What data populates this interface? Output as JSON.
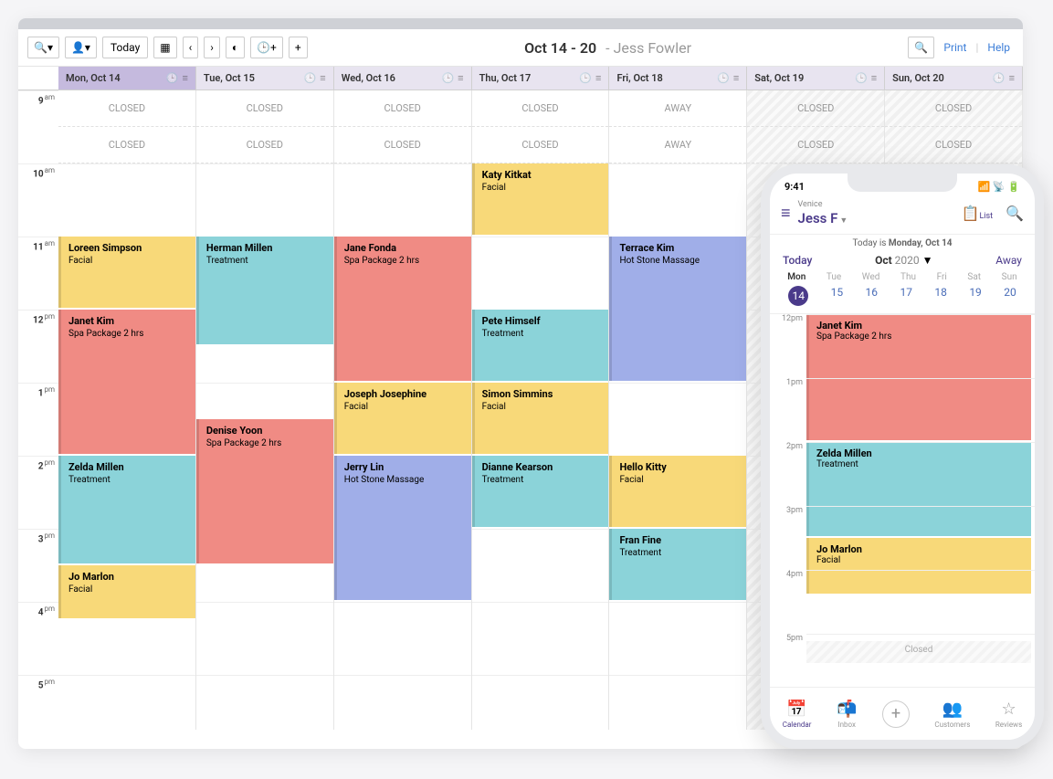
{
  "toolbar": {
    "today_label": "Today",
    "title_range": "Oct 14 - 20",
    "title_person": "- Jess Fowler",
    "print_label": "Print",
    "help_label": "Help"
  },
  "days": [
    {
      "label": "Mon, Oct 14",
      "selected": true,
      "status": "CLOSED"
    },
    {
      "label": "Tue, Oct 15",
      "selected": false,
      "status": "CLOSED"
    },
    {
      "label": "Wed, Oct 16",
      "selected": false,
      "status": "CLOSED"
    },
    {
      "label": "Thu, Oct 17",
      "selected": false,
      "status": "CLOSED"
    },
    {
      "label": "Fri, Oct 18",
      "selected": false,
      "status": "AWAY"
    },
    {
      "label": "Sat, Oct 19",
      "selected": false,
      "status": "CLOSED"
    },
    {
      "label": "Sun, Oct 20",
      "selected": false,
      "status": "CLOSED"
    }
  ],
  "hours": [
    "9",
    "10",
    "11",
    "12",
    "1",
    "2",
    "3",
    "4",
    "5"
  ],
  "ampm": [
    "am",
    "am",
    "am",
    "pm",
    "pm",
    "pm",
    "pm",
    "pm",
    "pm"
  ],
  "closed_text": "CLOSED",
  "away_text": "AWAY",
  "appointments": [
    {
      "day": 3,
      "start": 10,
      "dur": 1,
      "name": "Katy Kitkat",
      "service": "Facial",
      "color": "c-yellow"
    },
    {
      "day": 0,
      "start": 11,
      "dur": 1,
      "name": "Loreen Simpson",
      "service": "Facial",
      "color": "c-yellow"
    },
    {
      "day": 1,
      "start": 11,
      "dur": 1.5,
      "name": "Herman Millen",
      "service": "Treatment",
      "color": "c-teal"
    },
    {
      "day": 2,
      "start": 11,
      "dur": 2,
      "name": "Jane Fonda",
      "service": "Spa Package 2 hrs",
      "color": "c-red"
    },
    {
      "day": 4,
      "start": 11,
      "dur": 2,
      "name": "Terrace Kim",
      "service": "Hot Stone Massage",
      "color": "c-blue"
    },
    {
      "day": 0,
      "start": 12,
      "dur": 2,
      "name": "Janet Kim",
      "service": "Spa Package 2 hrs",
      "color": "c-red"
    },
    {
      "day": 3,
      "start": 12,
      "dur": 1,
      "name": "Pete Himself",
      "service": "Treatment",
      "color": "c-teal"
    },
    {
      "day": 2,
      "start": 13,
      "dur": 1,
      "name": "Joseph Josephine",
      "service": "Facial",
      "color": "c-yellow"
    },
    {
      "day": 3,
      "start": 13,
      "dur": 1,
      "name": "Simon Simmins",
      "service": "Facial",
      "color": "c-yellow"
    },
    {
      "day": 1,
      "start": 13.5,
      "dur": 2,
      "name": "Denise Yoon",
      "service": "Spa Package 2 hrs",
      "color": "c-red"
    },
    {
      "day": 0,
      "start": 14,
      "dur": 1.5,
      "name": "Zelda Millen",
      "service": "Treatment",
      "color": "c-teal"
    },
    {
      "day": 2,
      "start": 14,
      "dur": 2,
      "name": "Jerry Lin",
      "service": "Hot Stone Massage",
      "color": "c-blue"
    },
    {
      "day": 3,
      "start": 14,
      "dur": 1,
      "name": "Dianne Kearson",
      "service": "Treatment",
      "color": "c-teal"
    },
    {
      "day": 4,
      "start": 14,
      "dur": 1,
      "name": "Hello Kitty",
      "service": "Facial",
      "color": "c-yellow"
    },
    {
      "day": 4,
      "start": 15,
      "dur": 1,
      "name": "Fran Fine",
      "service": "Treatment",
      "color": "c-teal"
    },
    {
      "day": 0,
      "start": 15.5,
      "dur": 0.75,
      "name": "Jo Marlon",
      "service": "Facial",
      "color": "c-yellow"
    }
  ],
  "phone": {
    "time": "9:41",
    "location": "Venice",
    "user": "Jess F",
    "list_label": "List",
    "today_is": "Today is",
    "today_date": "Monday, Oct 14",
    "today_link": "Today",
    "month": "Oct",
    "year": "2020",
    "away_label": "Away",
    "daynames": [
      "Mon",
      "Tue",
      "Wed",
      "Thu",
      "Fri",
      "Sat",
      "Sun"
    ],
    "dates": [
      "14",
      "15",
      "16",
      "17",
      "18",
      "19",
      "20"
    ],
    "hours": [
      "12pm",
      "1pm",
      "2pm",
      "3pm",
      "4pm",
      "5pm"
    ],
    "closed_text": "Closed",
    "appointments": [
      {
        "start": 12,
        "dur": 2,
        "name": "Janet Kim",
        "service": "Spa Package 2 hrs",
        "color": "c-red"
      },
      {
        "start": 14,
        "dur": 1.5,
        "name": "Zelda Millen",
        "service": "Treatment",
        "color": "c-teal"
      },
      {
        "start": 15.5,
        "dur": 0.9,
        "name": "Jo Marlon",
        "service": "Facial",
        "color": "c-yellow"
      }
    ],
    "tabs": [
      {
        "label": "Calendar",
        "icon": "📅",
        "active": true
      },
      {
        "label": "Inbox",
        "icon": "📬",
        "active": false
      },
      {
        "label": "",
        "icon": "+",
        "active": false,
        "plus": true
      },
      {
        "label": "Customers",
        "icon": "👥",
        "active": false
      },
      {
        "label": "Reviews",
        "icon": "☆",
        "active": false
      }
    ]
  }
}
